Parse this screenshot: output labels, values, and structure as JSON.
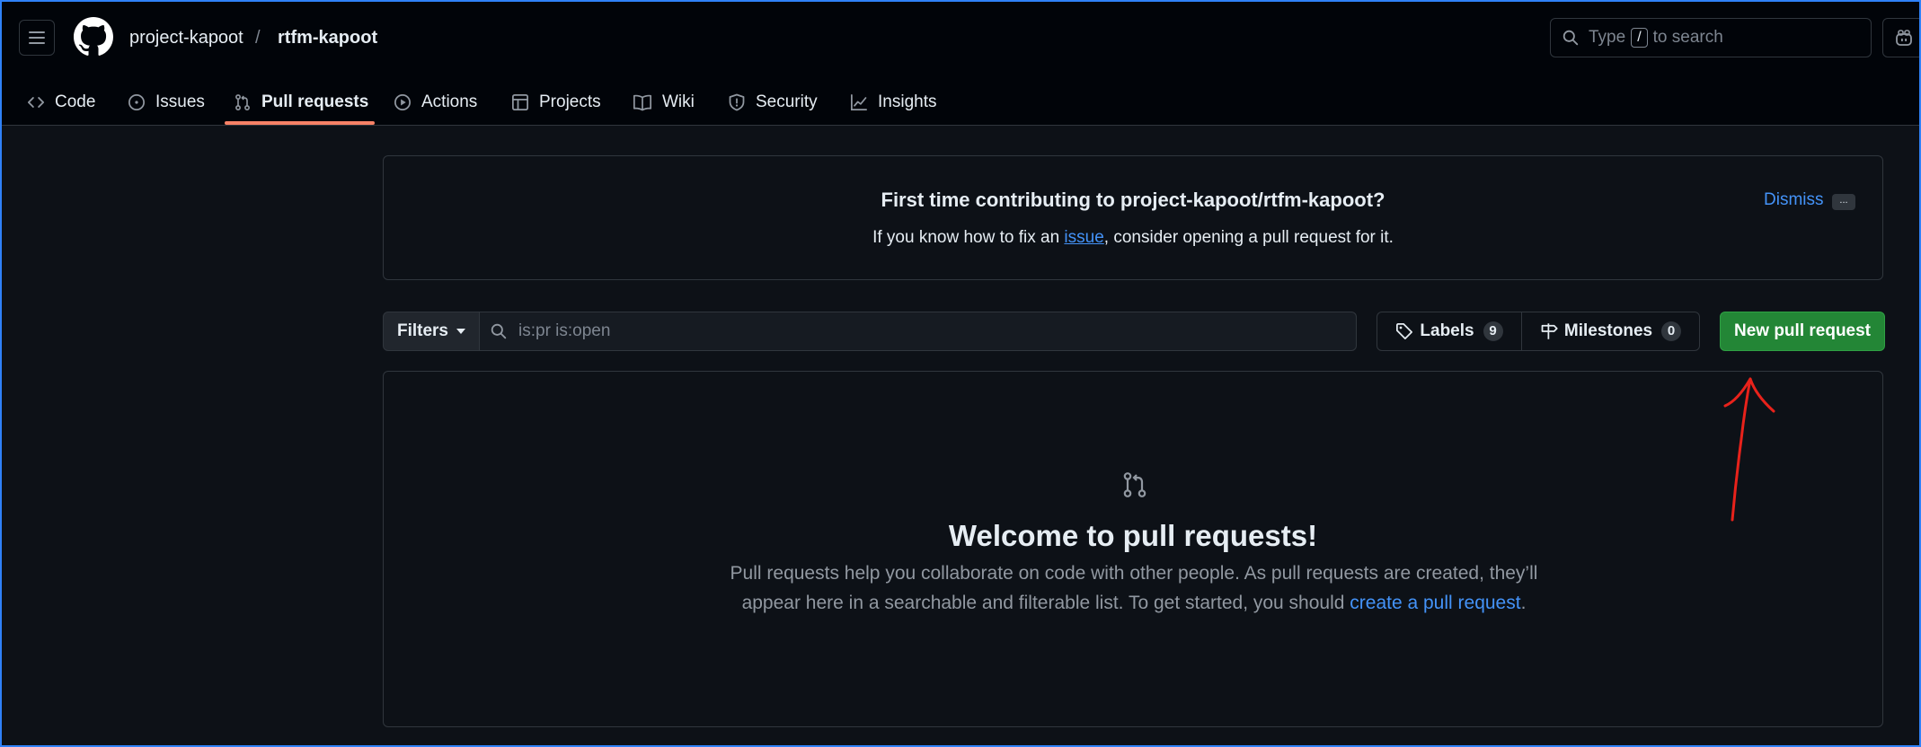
{
  "header": {
    "owner": "project-kapoot",
    "separator": "/",
    "repo": "rtfm-kapoot",
    "search": {
      "prefix": "Type",
      "key": "/",
      "suffix": "to search"
    }
  },
  "tabs": [
    {
      "label": "Code",
      "icon": "code-icon"
    },
    {
      "label": "Issues",
      "icon": "issue-opened-icon"
    },
    {
      "label": "Pull requests",
      "icon": "git-pull-request-icon",
      "active": true
    },
    {
      "label": "Actions",
      "icon": "play-icon"
    },
    {
      "label": "Projects",
      "icon": "table-icon"
    },
    {
      "label": "Wiki",
      "icon": "book-icon"
    },
    {
      "label": "Security",
      "icon": "shield-icon"
    },
    {
      "label": "Insights",
      "icon": "graph-icon"
    }
  ],
  "contributing": {
    "title": "First time contributing to project-kapoot/rtfm-kapoot?",
    "desc_before": "If you know how to fix an ",
    "desc_link": "issue",
    "desc_after": ", consider opening a pull request for it.",
    "dismiss": "Dismiss",
    "more": "..."
  },
  "filterbar": {
    "filters_label": "Filters",
    "query": "is:pr is:open",
    "labels_label": "Labels",
    "labels_count": "9",
    "milestones_label": "Milestones",
    "milestones_count": "0",
    "new_pr_label": "New pull request"
  },
  "blankslate": {
    "title": "Welcome to pull requests!",
    "desc_line1": "Pull requests help you collaborate on code with other people. As pull requests are created, they’ll",
    "desc_line2_before": "appear here in a searchable and filterable list. To get started, you should ",
    "desc_link": "create a pull request",
    "desc_after": "."
  },
  "colors": {
    "accent_link": "#4493f8",
    "primary_button": "#238636",
    "tab_underline": "#f78166",
    "annotation": "#e8221b"
  }
}
